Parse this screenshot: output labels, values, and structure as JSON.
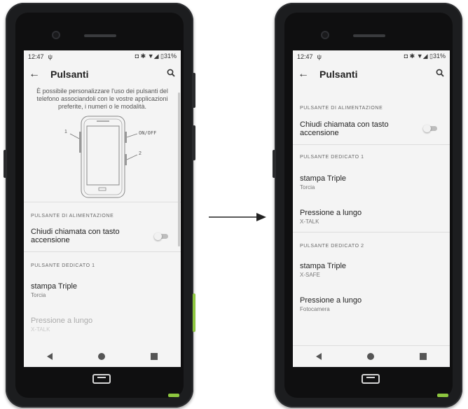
{
  "left_phone": {
    "status": {
      "time": "12:47",
      "usb": "ψ",
      "right": "◘ ✱ ▼◢ ▯31%"
    },
    "appbar": {
      "title": "Pulsanti",
      "back": "←",
      "search": "search"
    },
    "intro_text": "È possibile personalizzare l'uso dei pulsanti del telefono associandoli con le vostre applicazioni preferite, i numeri o le modalità.",
    "diagram": {
      "label_1": "1",
      "label_onoff": "ON/OFF",
      "label_2": "2"
    },
    "section_power": "PULSANTE DI ALIMENTAZIONE",
    "power_pref": {
      "title": "Chiudi chiamata con tasto accensione",
      "toggle_on": false
    },
    "section_dedicated1": "PULSANTE DEDICATO 1",
    "triple": {
      "title": "stampa Triple",
      "summary": "Torcia"
    },
    "long": {
      "title": "Pressione a lungo",
      "summary": "X-TALK"
    }
  },
  "right_phone": {
    "status": {
      "time": "12:47",
      "usb": "ψ",
      "right": "◘ ✱ ▼◢ ▯31%"
    },
    "appbar": {
      "title": "Pulsanti",
      "back": "←",
      "search": "search"
    },
    "section_power": "PULSANTE DI ALIMENTAZIONE",
    "power_pref": {
      "title": "Chiudi chiamata con tasto accensione",
      "toggle_on": false
    },
    "section_dedicated1": "PULSANTE DEDICATO 1",
    "triple1": {
      "title": "stampa Triple",
      "summary": "Torcia"
    },
    "long1": {
      "title": "Pressione a lungo",
      "summary": "X-TALK"
    },
    "section_dedicated2": "PULSANTE DEDICATO 2",
    "triple2": {
      "title": "stampa Triple",
      "summary": "X-SAFE"
    },
    "long2": {
      "title": "Pressione a lungo",
      "summary": "Fotocamera"
    }
  },
  "icons": {
    "arrow": "arrow-right-icon",
    "search": "search-icon",
    "back": "back-arrow-icon"
  },
  "colors": {
    "phone_body": "#1c1d1f",
    "screen_bg": "#f4f4f4",
    "accent_green": "#8dc63f"
  }
}
